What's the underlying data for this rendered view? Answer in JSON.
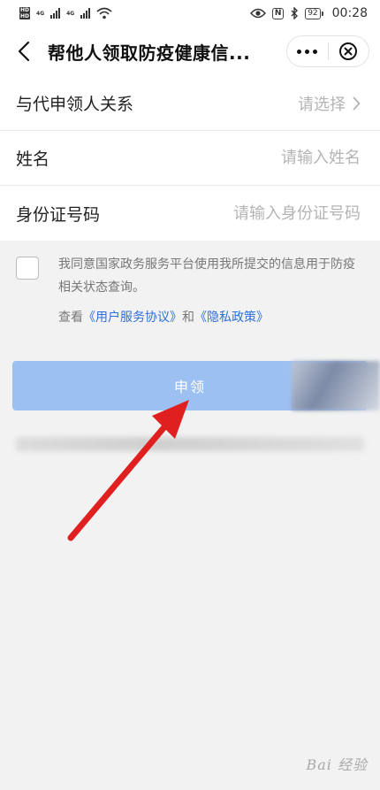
{
  "status_bar": {
    "sim_tags": [
      "HD",
      "HD"
    ],
    "net_1": "4G",
    "net_2": "4G",
    "battery": "92",
    "nfc": "N",
    "time": "00:28"
  },
  "navbar": {
    "title": "帮他人领取防疫健康信...",
    "back_icon": "chevron-left-icon",
    "more_icon": "more-dots-icon",
    "close_icon": "close-circle-icon"
  },
  "form": {
    "relation": {
      "label": "与代申领人关系",
      "value": "请选择"
    },
    "name": {
      "label": "姓名",
      "placeholder": "请输入姓名"
    },
    "id_number": {
      "label": "身份证号码",
      "placeholder": "请输入身份证号码"
    }
  },
  "agreement": {
    "text": "我同意国家政务服务平台使用我所提交的信息用于防疫相关状态查询。",
    "see_prefix": "查看",
    "link_terms": "《用户服务协议》",
    "and": "和",
    "link_privacy": "《隐私政策》",
    "checked": false
  },
  "apply_button": {
    "label": "申领",
    "color": "#9dc0f2"
  },
  "colors": {
    "link": "#2f6fd8",
    "arrow": "#e0201e"
  },
  "watermark": "Bai 经验"
}
